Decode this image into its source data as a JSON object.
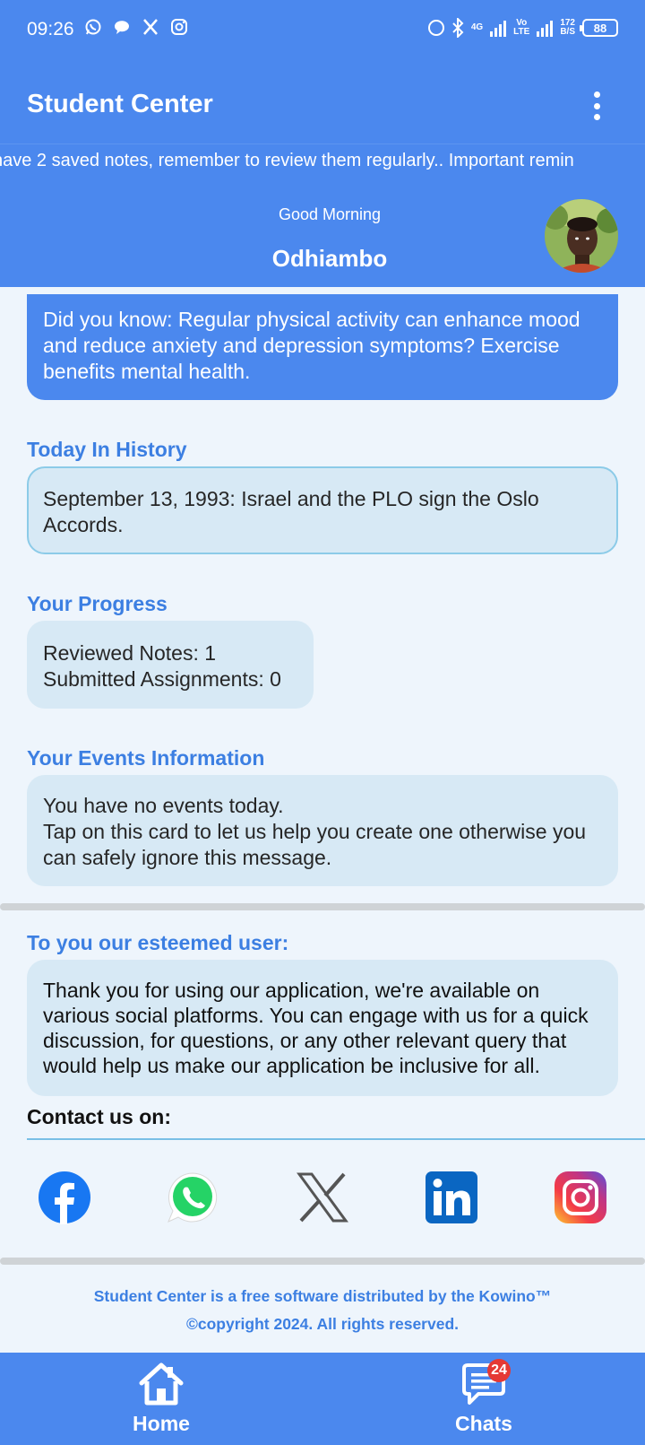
{
  "status_bar": {
    "time": "09:26",
    "left_icons": [
      "whatsapp-icon",
      "chat-bubble-icon",
      "x-icon",
      "instagram-icon"
    ],
    "network_1": "4G",
    "network_2_top": "Vo",
    "network_2_bottom": "LTE",
    "speed_value": "172",
    "speed_unit": "B/S",
    "battery": "88"
  },
  "app_bar": {
    "title": "Student Center",
    "menu_icon": "more-vert-icon"
  },
  "ticker": {
    "text": "have 2 saved notes, remember to review them regularly.. Important remin"
  },
  "greeting": {
    "salutation": "Good Morning",
    "name": "Odhiambo"
  },
  "did_you_know": {
    "text": "Did you know: Regular physical activity can enhance mood and reduce anxiety and depression symptoms? Exercise benefits mental health."
  },
  "history": {
    "title": "Today In History",
    "text": "September 13, 1993: Israel and the PLO sign the Oslo Accords."
  },
  "progress": {
    "title": "Your Progress",
    "reviewed_notes": "Reviewed Notes: 1",
    "submitted_assignments": "Submitted Assignments: 0"
  },
  "events": {
    "title": "Your Events Information",
    "line1": "You have no events today.",
    "line2": "Tap on this card to let us help you create one otherwise you can safely ignore this message."
  },
  "esteemed": {
    "title": "To you our esteemed user:",
    "text": "Thank you for using our application, we're available on various social platforms. You can engage with us for a quick discussion, for questions, or any other relevant query that would help us make our application be inclusive for all."
  },
  "contact": {
    "label": "Contact us on:",
    "platforms": [
      "facebook-icon",
      "whatsapp-icon",
      "x-icon",
      "linkedin-icon",
      "instagram-icon"
    ]
  },
  "footer": {
    "line1": "Student Center is a free software distributed by the Kowino™",
    "line2": "©copyright 2024. All rights reserved."
  },
  "bottom_nav": {
    "home_label": "Home",
    "chats_label": "Chats",
    "chats_badge": "24"
  },
  "colors": {
    "primary": "#4b88ee",
    "accent_text": "#3c7fe2",
    "card_bg": "#d7e9f5",
    "page_bg": "#eef5fc",
    "badge": "#e53935"
  }
}
